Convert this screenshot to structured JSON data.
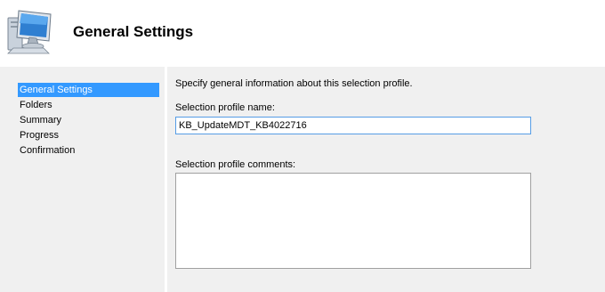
{
  "header": {
    "title": "General Settings",
    "icon": "computer-monitor-icon"
  },
  "nav": {
    "items": [
      {
        "label": "General Settings",
        "selected": true
      },
      {
        "label": "Folders",
        "selected": false
      },
      {
        "label": "Summary",
        "selected": false
      },
      {
        "label": "Progress",
        "selected": false
      },
      {
        "label": "Confirmation",
        "selected": false
      }
    ]
  },
  "main": {
    "description": "Specify general information about this selection profile.",
    "name_label": "Selection profile name:",
    "name_value": "KB_UpdateMDT_KB4022716",
    "comments_label": "Selection profile comments:",
    "comments_value": ""
  },
  "colors": {
    "selection": "#3399ff",
    "input_focus_border": "#569de5"
  }
}
